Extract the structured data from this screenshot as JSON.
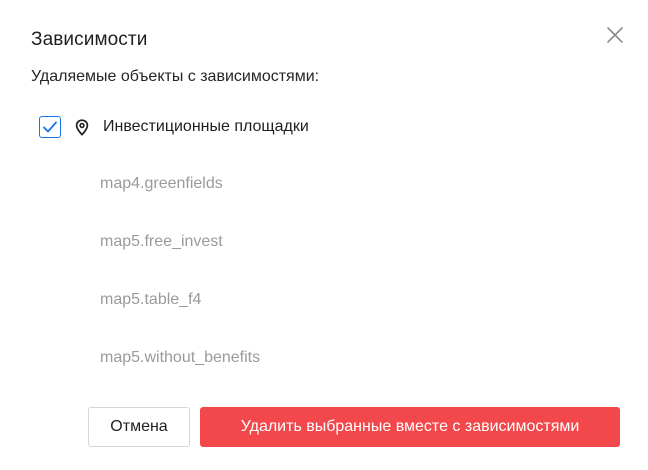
{
  "dialog": {
    "title": "Зависимости",
    "subtitle": "Удаляемые объекты с зависимостями:",
    "close_icon": "close-icon"
  },
  "group": {
    "checked": true,
    "icon": "map-pin-icon",
    "label": "Инвестиционные площадки",
    "accent_color": "#1a73e8"
  },
  "dependencies": [
    "map4.greenfields",
    "map5.free_invest",
    "map5.table_f4",
    "map5.without_benefits"
  ],
  "actions": {
    "cancel_label": "Отмена",
    "delete_label": "Удалить выбранные вместе с зависимостями",
    "delete_color": "#f2474b"
  }
}
